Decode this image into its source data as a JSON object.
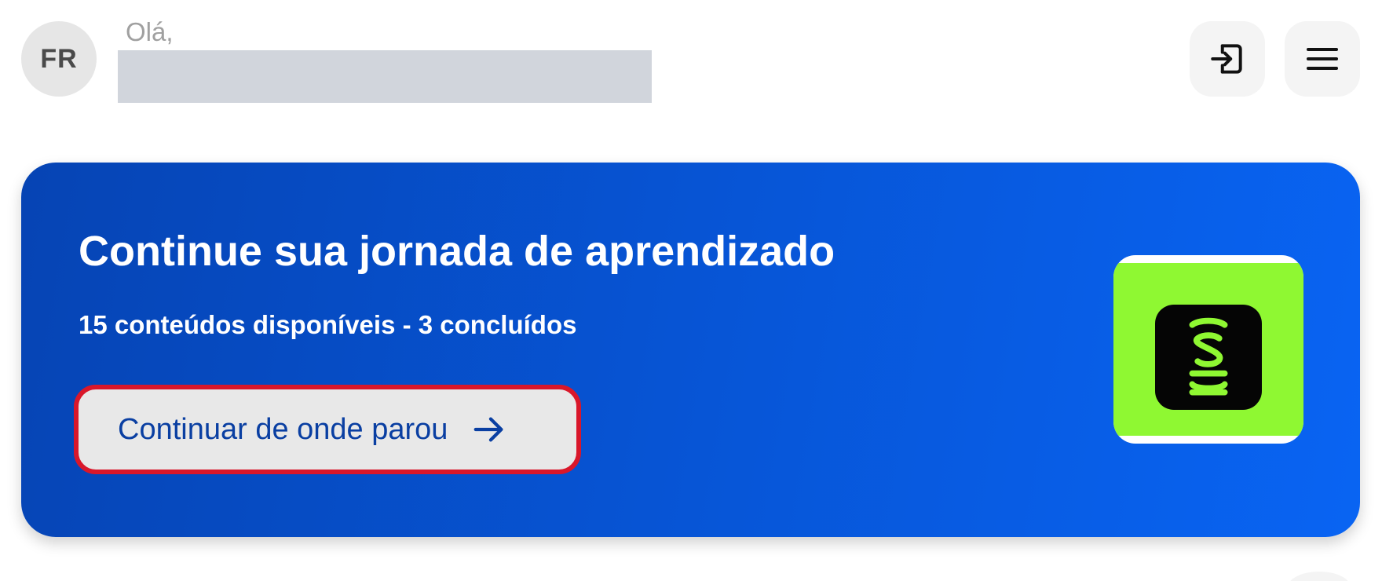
{
  "header": {
    "avatar_initials": "FR",
    "greeting": "Olá,",
    "logout_icon": "logout-icon",
    "menu_icon": "hamburger-menu-icon"
  },
  "hero": {
    "title": "Continue sua jornada de aprendizado",
    "subtitle": "15 conteúdos disponíveis - 3 concluídos",
    "continue_label": "Continuar de onde parou",
    "continue_icon": "arrow-right-icon",
    "thumbnail_icon": "app-logo-icon",
    "colors": {
      "card_gradient_start": "#0644b4",
      "card_gradient_end": "#0964f3",
      "button_text": "#0a3fa2",
      "highlight_border": "#d9172a",
      "thumbnail_bg": "#8ff832"
    }
  }
}
